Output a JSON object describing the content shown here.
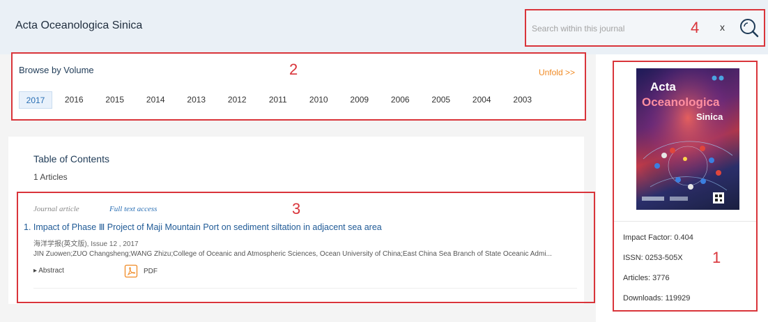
{
  "header": {
    "title": "Acta Oceanologica Sinica"
  },
  "search": {
    "placeholder": "Search within this journal",
    "marker": "4",
    "clear": "x"
  },
  "browse": {
    "title": "Browse by Volume",
    "marker": "2",
    "unfold": "Unfold >>",
    "years": [
      "2017",
      "2016",
      "2015",
      "2014",
      "2013",
      "2012",
      "2011",
      "2010",
      "2009",
      "2006",
      "2005",
      "2004",
      "2003"
    ],
    "selected": "2017"
  },
  "toc": {
    "title": "Table of Contents",
    "count": "1 Articles",
    "marker": "3",
    "article": {
      "type": "Journal article",
      "access": "Full text access",
      "title": "1. Impact of Phase Ⅲ Project of Maji Mountain Port on sediment siltation in adjacent sea area",
      "source": "海洋学报(英文版), Issue 12 , 2017",
      "authors": "JIN Zuowen;ZUO Changsheng;WANG Zhizu;College of Oceanic and Atmospheric Sciences, Ocean University of China;East China Sea Branch of State Oceanic Admi...",
      "abstract_label": "▸ Abstract",
      "pdf_label": "PDF"
    }
  },
  "sidebar": {
    "marker": "1",
    "cover_text": [
      "Acta",
      "Oceanologica",
      "Sinica"
    ],
    "stats": [
      "Impact Factor: 0.404",
      "ISSN: 0253-505X",
      "Articles: 3776",
      "Downloads: 119929"
    ]
  },
  "colors": {
    "annotation": "#d9343a",
    "link": "#1f5a96",
    "unfold": "#f08a24",
    "header_bg": "#eaf0f6"
  }
}
